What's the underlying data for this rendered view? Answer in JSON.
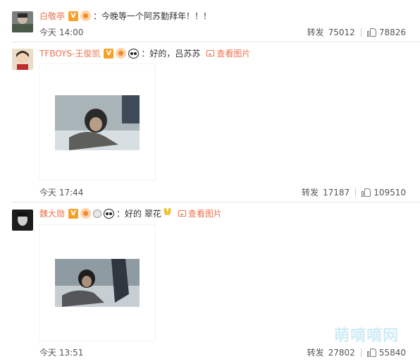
{
  "comments": [
    {
      "username": "白敬亭",
      "badge": "V",
      "text": "：今晚等一个阿苏勤拜年！！！",
      "time": "今天 14:00",
      "repost_label": "转发",
      "repost_count": "75012",
      "like_count": "78826"
    },
    {
      "username": "TFBOYS-王俊凯",
      "badge": "V",
      "text": "：好的，吕苏苏",
      "view_pic": "查看图片",
      "time": "今天 17:44",
      "repost_label": "转发",
      "repost_count": "17187",
      "like_count": "109510"
    },
    {
      "username": "魏大勋",
      "badge": "V",
      "text": "：好的 翠花",
      "view_pic": "查看图片",
      "time": "今天 13:51",
      "repost_label": "转发",
      "repost_count": "27802",
      "like_count": "55840"
    }
  ],
  "watermark": "萌嘀嘀网",
  "colors": {
    "username": "#eb7350",
    "badge": "#f7a12b",
    "text": "#333333",
    "meta": "#555555",
    "divider": "#e6e6e6"
  }
}
